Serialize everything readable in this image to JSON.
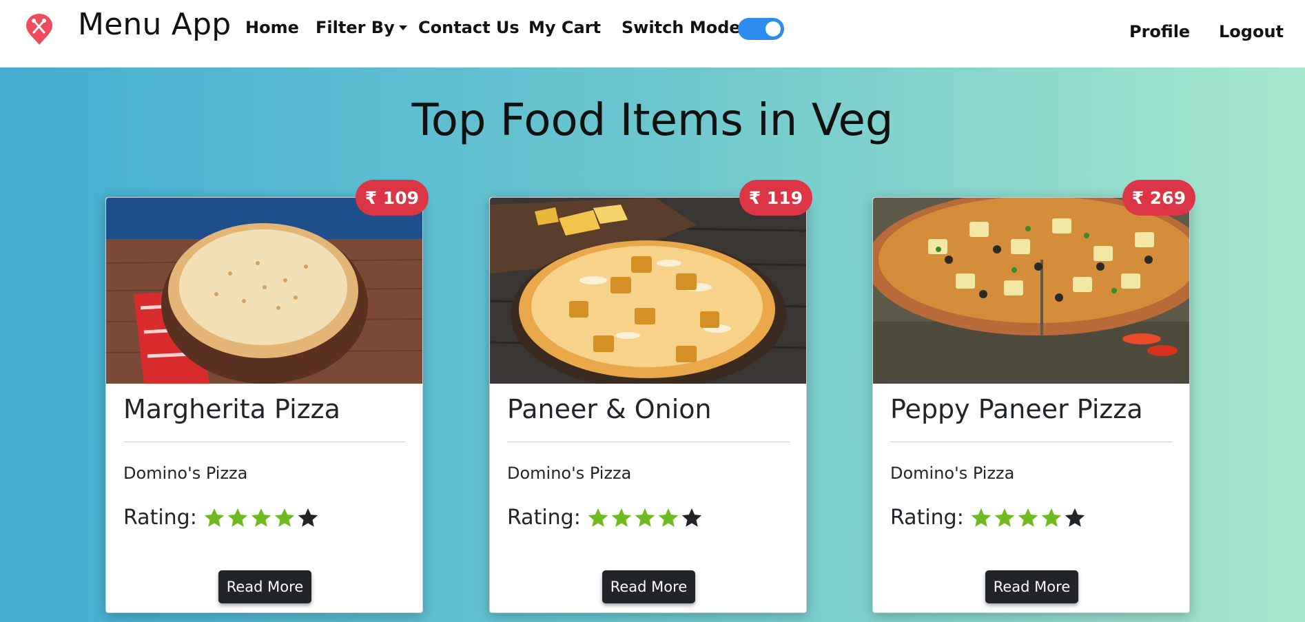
{
  "nav": {
    "brand": "Menu App",
    "logo_icon": "utensils-pin-icon",
    "links": {
      "home": "Home",
      "filter": "Filter By",
      "contact": "Contact Us",
      "cart": "My Cart",
      "switch_mode": "Switch Mode",
      "profile": "Profile",
      "logout": "Logout"
    },
    "switch_mode_on": true
  },
  "page": {
    "title": "Top Food Items in Veg"
  },
  "colors": {
    "badge": "#dc3545",
    "star_filled": "#6fba1f",
    "star_empty": "#212529",
    "toggle": "#2d8cf0",
    "button": "#212529"
  },
  "cards": [
    {
      "price": "₹ 109",
      "title": "Margherita Pizza",
      "restaurant": "Domino's Pizza",
      "rating_label": "Rating:",
      "rating": 4,
      "rating_max": 5,
      "button": "Read More"
    },
    {
      "price": "₹ 119",
      "title": "Paneer & Onion",
      "restaurant": "Domino's Pizza",
      "rating_label": "Rating:",
      "rating": 4,
      "rating_max": 5,
      "button": "Read More"
    },
    {
      "price": "₹ 269",
      "title": "Peppy Paneer Pizza",
      "restaurant": "Domino's Pizza",
      "rating_label": "Rating:",
      "rating": 4,
      "rating_max": 5,
      "button": "Read More"
    }
  ]
}
